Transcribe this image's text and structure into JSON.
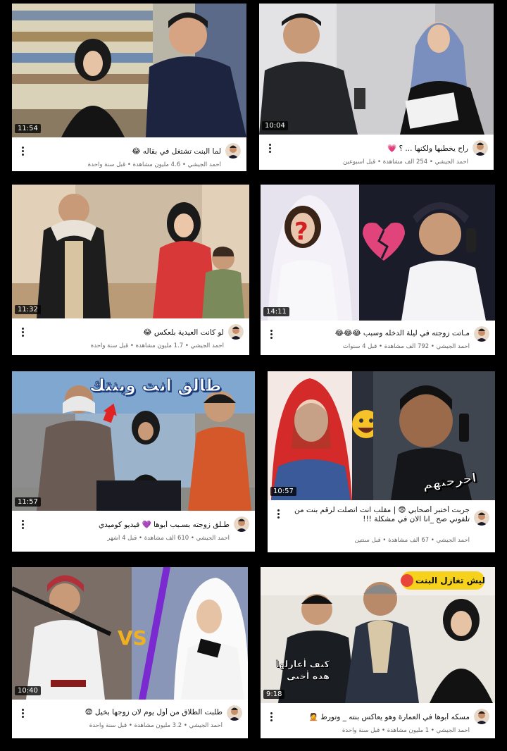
{
  "videos": [
    {
      "duration": "11:54",
      "title": "لما البنت تشتغل في بقاله 😂",
      "channel": "أحمد الجيشي",
      "views": "4.6 مليون مشاهدة",
      "age": "قبل سنة واحدة"
    },
    {
      "duration": "10:04",
      "title": "راح يخطبها ولكنها ... ؟ 💗",
      "channel": "أحمد الجيشي",
      "views": "254 ألف مشاهدة",
      "age": "قبل أسبوعين"
    },
    {
      "duration": "11:32",
      "title": "لو كانت العيدية بلعكس 😂",
      "channel": "أحمد الجيشي",
      "views": "1.7 مليون مشاهدة",
      "age": "قبل سنة واحدة"
    },
    {
      "duration": "14:11",
      "title": "مـاتت زوجته في ليلة الدخله وسبب 😂😂😂",
      "channel": "أحمد الجيشي",
      "views": "792 ألف مشاهدة",
      "age": "قبل 4 سنوات"
    },
    {
      "duration": "11:57",
      "title": "طـلق زوجته بسـبب أبوها 💜 فيديو كوميدي",
      "channel": "أحمد الجيشي",
      "views": "610 ألف مشاهدة",
      "age": "قبل 4 أشهر",
      "overlay": "طالق انت وبنتك"
    },
    {
      "duration": "10:57",
      "title": "جربت أختبر أصحابي 😨 | مقلب انت اتصلت لرقم بنت من تلفوني صح _انا الان في مشكلة !!!",
      "channel": "أحمد الجيشي",
      "views": "67 ألف مشاهدة",
      "age": "قبل سنتين",
      "overlay": "احرجتهم"
    },
    {
      "duration": "10:40",
      "title": "طلبت الطلاق من أول يوم لان زوجها بخيل 😨",
      "channel": "أحمد الجيشي",
      "views": "3.2 مليون مشاهدة",
      "age": "قبل سنة واحدة",
      "overlay": "VS"
    },
    {
      "duration": "9:18",
      "title": "مسكه أبوها في العمارة وهو يعاكس بنته _ وتورط 🤦",
      "channel": "أحمد الجيشي",
      "views": "1 مليون مشاهدة",
      "age": "قبل سنة واحدة",
      "overlay": "ليش تغازل البنت",
      "overlay2": "كيف أغازلها هذه أختي"
    }
  ],
  "colors": {
    "background": "#000000",
    "card": "#ffffff",
    "title": "#111111",
    "meta": "#666666"
  }
}
